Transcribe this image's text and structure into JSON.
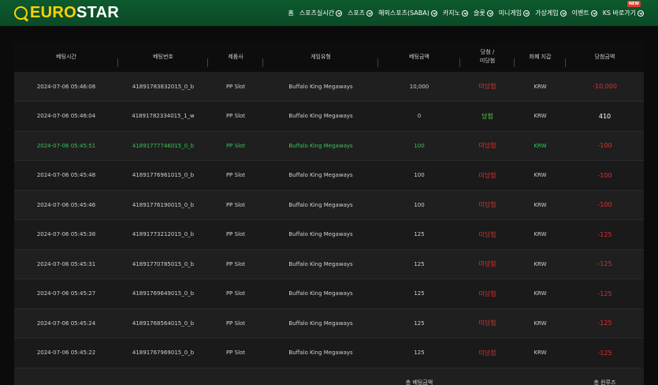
{
  "brand": {
    "part1": "EURO",
    "part2": "STAR"
  },
  "nav": [
    {
      "label": "홈",
      "chevron": false
    },
    {
      "label": "스포츠실시간",
      "chevron": true
    },
    {
      "label": "스포츠",
      "chevron": true
    },
    {
      "label": "해외스포츠(SABA)",
      "chevron": true
    },
    {
      "label": "카지노",
      "chevron": true
    },
    {
      "label": "슬롯",
      "chevron": true
    },
    {
      "label": "미니게임",
      "chevron": true
    },
    {
      "label": "가상게임",
      "chevron": true
    },
    {
      "label": "이벤트",
      "chevron": true
    },
    {
      "label": "KS 바로가기",
      "chevron": true,
      "badge": "NEW"
    }
  ],
  "table": {
    "headers": [
      "베팅시간",
      "베팅번호",
      "제품사",
      "게임유형",
      "베팅금액",
      "당첨 /\n미당첨",
      "화폐 지갑",
      "당첨금액"
    ],
    "rows": [
      {
        "time": "2024-07-06 05:46:08",
        "id": "41891783832015_0_b",
        "provider": "PP Slot",
        "game": "Buffalo King Megaways",
        "amount": "10,000",
        "result": "미당첨",
        "currency": "KRW",
        "payout": "-10,000"
      },
      {
        "time": "2024-07-06 05:46:04",
        "id": "41891782334015_1_w",
        "provider": "PP Slot",
        "game": "Buffalo King Megaways",
        "amount": "0",
        "result": "당첨",
        "currency": "KRW",
        "payout": "410"
      },
      {
        "time": "2024-07-06 05:45:51",
        "id": "41891777746015_0_b",
        "provider": "PP Slot",
        "game": "Buffalo King Megaways",
        "amount": "100",
        "result": "미당첨",
        "currency": "KRW",
        "payout": "-100"
      },
      {
        "time": "2024-07-06 05:45:48",
        "id": "41891776961015_0_b",
        "provider": "PP Slot",
        "game": "Buffalo King Megaways",
        "amount": "100",
        "result": "미당첨",
        "currency": "KRW",
        "payout": "-100"
      },
      {
        "time": "2024-07-06 05:45:46",
        "id": "41891776190015_0_b",
        "provider": "PP Slot",
        "game": "Buffalo King Megaways",
        "amount": "100",
        "result": "미당첨",
        "currency": "KRW",
        "payout": "-100"
      },
      {
        "time": "2024-07-06 05:45:38",
        "id": "41891773212015_0_b",
        "provider": "PP Slot",
        "game": "Buffalo King Megaways",
        "amount": "125",
        "result": "미당첨",
        "currency": "KRW",
        "payout": "-125"
      },
      {
        "time": "2024-07-06 05:45:31",
        "id": "41891770785015_0_b",
        "provider": "PP Slot",
        "game": "Buffalo King Megaways",
        "amount": "125",
        "result": "미당첨",
        "currency": "KRW",
        "payout": "-125"
      },
      {
        "time": "2024-07-06 05:45:27",
        "id": "41891769649015_0_b",
        "provider": "PP Slot",
        "game": "Buffalo King Megaways",
        "amount": "125",
        "result": "미당첨",
        "currency": "KRW",
        "payout": "-125"
      },
      {
        "time": "2024-07-06 05:45:24",
        "id": "41891768564015_0_b",
        "provider": "PP Slot",
        "game": "Buffalo King Megaways",
        "amount": "125",
        "result": "미당첨",
        "currency": "KRW",
        "payout": "-125"
      },
      {
        "time": "2024-07-06 05:45:22",
        "id": "41891767969015_0_b",
        "provider": "PP Slot",
        "game": "Buffalo King Megaways",
        "amount": "125",
        "result": "미당첨",
        "currency": "KRW",
        "payout": "-125"
      }
    ],
    "highlight_row": 2,
    "totals": {
      "bet_label": "총 베팅금액",
      "win_label": "총 윈루즈"
    }
  },
  "colors": {
    "header_green": "#0d5a2e",
    "brand_yellow": "#ffd200",
    "lose_red": "#e0302c",
    "win_green": "#59d13b",
    "row_highlight": "#36c45a"
  }
}
